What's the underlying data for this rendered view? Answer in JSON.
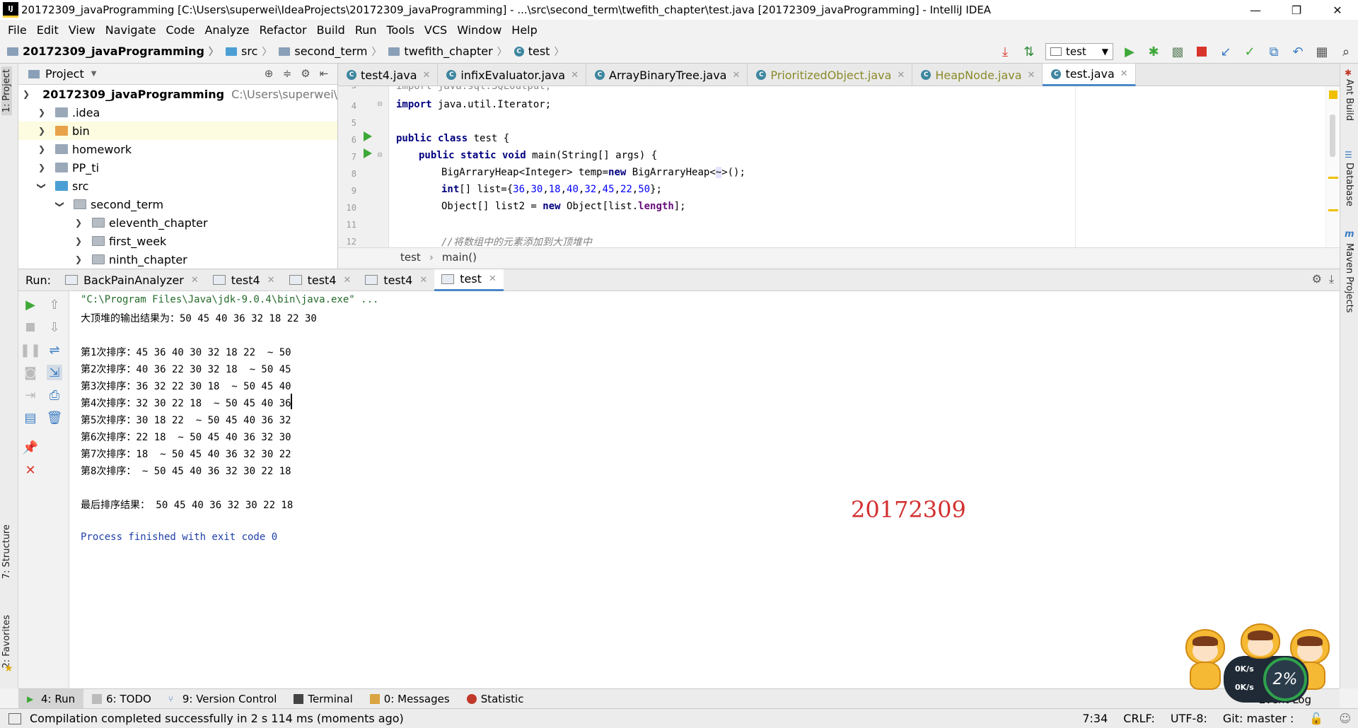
{
  "window": {
    "title": "20172309_javaProgramming [C:\\Users\\superwei\\IdeaProjects\\20172309_javaProgramming] - ...\\src\\second_term\\twefith_chapter\\test.java [20172309_javaProgramming] - IntelliJ IDEA",
    "minimize": "—",
    "restore": "❐",
    "close": "✕"
  },
  "menu": [
    "File",
    "Edit",
    "View",
    "Navigate",
    "Code",
    "Analyze",
    "Refactor",
    "Build",
    "Run",
    "Tools",
    "VCS",
    "Window",
    "Help"
  ],
  "breadcrumb": [
    {
      "label": "20172309_javaProgramming"
    },
    {
      "label": "src"
    },
    {
      "label": "second_term"
    },
    {
      "label": "twefith_chapter"
    },
    {
      "label": "test"
    }
  ],
  "run_config": {
    "name": "test"
  },
  "project_panel": {
    "title": "Project",
    "tree": [
      {
        "label": "20172309_javaProgramming",
        "path": "C:\\Users\\superwei\\IdeaP",
        "depth": 0,
        "expanded": true
      },
      {
        "label": ".idea",
        "depth": 1,
        "expanded": false
      },
      {
        "label": "bin",
        "depth": 1,
        "expanded": false
      },
      {
        "label": "homework",
        "depth": 1,
        "expanded": false
      },
      {
        "label": "PP_ti",
        "depth": 1,
        "expanded": false
      },
      {
        "label": "src",
        "depth": 1,
        "expanded": true
      },
      {
        "label": "second_term",
        "depth": 2,
        "expanded": true
      },
      {
        "label": "eleventh_chapter",
        "depth": 3,
        "expanded": false
      },
      {
        "label": "first_week",
        "depth": 3,
        "expanded": false
      },
      {
        "label": "ninth_chapter",
        "depth": 3,
        "expanded": false
      }
    ]
  },
  "editor_tabs": [
    {
      "label": "test4.java"
    },
    {
      "label": "infixEvaluator.java"
    },
    {
      "label": "ArrayBinaryTree.java"
    },
    {
      "label": "PrioritizedObject.java"
    },
    {
      "label": "HeapNode.java"
    },
    {
      "label": "test.java"
    }
  ],
  "editor": {
    "lines": [
      {
        "n": "3",
        "code": "import java.sql.SQLOutput;"
      },
      {
        "n": "4",
        "code": "import java.util.Iterator;"
      },
      {
        "n": "5",
        "code": ""
      },
      {
        "n": "6",
        "code": "public class test {"
      },
      {
        "n": "7",
        "code": "    public static void main(String[] args) {"
      },
      {
        "n": "8",
        "code": "        BigArraryHeap<Integer> temp=new BigArraryHeap<~>();"
      },
      {
        "n": "9",
        "code": "        int[] list={36,30,18,40,32,45,22,50};"
      },
      {
        "n": "10",
        "code": "        Object[] list2 = new Object[list.length];"
      },
      {
        "n": "11",
        "code": ""
      },
      {
        "n": "12",
        "code": "        //将数组中的元素添加到大顶堆中"
      }
    ],
    "tokens": {
      "line3": "import java.sql.SQLOutput;",
      "line4_kw": "import",
      "line4_rest": " java.util.Iterator;",
      "line6_kw": "public class",
      "line6_rest": " test {",
      "line7_kw": "public static void",
      "line7_rest": " main(String[] args) {",
      "line8_a": "BigArraryHeap<Integer> temp=",
      "line8_kw": "new",
      "line8_b": " BigArraryHeap<",
      "line8_tilde": "~",
      "line8_c": ">();",
      "line9_kw": "int",
      "line9_a": "[] list={",
      "line9_n1": "36",
      "line9_n2": "30",
      "line9_n3": "18",
      "line9_n4": "40",
      "line9_n5": "32",
      "line9_n6": "45",
      "line9_n7": "22",
      "line9_n8": "50",
      "line9_b": "};",
      "line10_a": "Object[] list2 = ",
      "line10_kw": "new",
      "line10_b": " Object[list.",
      "line10_fld": "length",
      "line10_c": "];",
      "line12": "//将数组中的元素添加到大顶堆中",
      "comma": ","
    },
    "crumb": [
      "test",
      "main()"
    ]
  },
  "run_panel": {
    "label": "Run:",
    "tabs": [
      {
        "label": "BackPainAnalyzer"
      },
      {
        "label": "test4"
      },
      {
        "label": "test4"
      },
      {
        "label": "test4"
      },
      {
        "label": "test"
      }
    ],
    "console": [
      "\"C:\\Program Files\\Java\\jdk-9.0.4\\bin\\java.exe\" ...",
      "大顶堆的输出结果为：50 45 40 36 32 18 22 30",
      "",
      "第1次排序：45 36 40 30 32 18 22  ~ 50",
      "第2次排序：40 36 22 30 32 18  ~ 50 45",
      "第3次排序：36 32 22 30 18  ~ 50 45 40",
      "第4次排序：32 30 22 18  ~ 50 45 40 36",
      "第5次排序：30 18 22  ~ 50 45 40 36 32",
      "第6次排序：22 18  ~ 50 45 40 36 32 30",
      "第7次排序：18  ~ 50 45 40 36 32 30 22",
      "第8次排序： ~ 50 45 40 36 32 30 22 18",
      "",
      "最后排序结果： 50 45 40 36 32 30 22 18",
      "",
      "Process finished with exit code 0"
    ],
    "watermark": "20172309"
  },
  "speed_widget": {
    "up": "0K/s",
    "down": "0K/s",
    "percent": "2%"
  },
  "bottom_tools": [
    {
      "label": "4: Run"
    },
    {
      "label": "6: TODO"
    },
    {
      "label": "9: Version Control"
    },
    {
      "label": "Terminal"
    },
    {
      "label": "0: Messages"
    },
    {
      "label": "Statistic"
    }
  ],
  "event_log": "Event Log",
  "left_vtabs": {
    "project": "1: Project",
    "structure": "7: Structure",
    "favorites": "2: Favorites"
  },
  "right_vtabs": {
    "ant": "Ant Build",
    "database": "Database",
    "maven": "Maven Projects"
  },
  "status": {
    "message": "Compilation completed successfully in 2 s 114 ms (moments ago)",
    "position": "7:34",
    "line_sep": "CRLF:",
    "encoding": "UTF-8:",
    "git": "Git: master :"
  },
  "colors": {
    "accent": "#4a88c7",
    "run_green": "#3ea838",
    "stop_red": "#d9342b",
    "watermark_red": "#d32f2f"
  }
}
